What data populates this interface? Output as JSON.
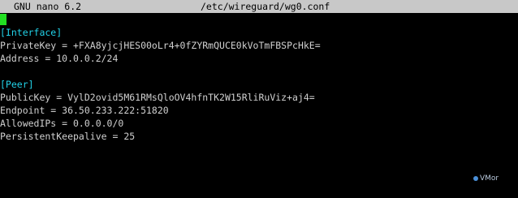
{
  "titlebar": {
    "app_name": "GNU nano 6.2",
    "file_name": "/etc/wireguard/wg0.conf"
  },
  "editor": {
    "lines": [
      {
        "text": "[Interface]",
        "kind": "section"
      },
      {
        "text": "PrivateKey = +FXA8yjcjHES00oLr4+0fZYRmQUCE0kVoTmFBSPcHkE=",
        "kind": "kv"
      },
      {
        "text": "Address = 10.0.0.2/24",
        "kind": "kv"
      },
      {
        "text": "",
        "kind": "blank"
      },
      {
        "text": "[Peer]",
        "kind": "section"
      },
      {
        "text": "PublicKey = VylD2ovid5M61RMsQloOV4hfnTK2W15RliRuViz+aj4=",
        "kind": "kv"
      },
      {
        "text": "Endpoint = 36.50.233.222:51820",
        "kind": "kv"
      },
      {
        "text": "AllowedIPs = 0.0.0.0/0",
        "kind": "kv"
      },
      {
        "text": "PersistentKeepalive = 25",
        "kind": "kv"
      }
    ]
  },
  "watermark": {
    "text": "VMor",
    "icon": "logo-dot-icon"
  },
  "colors": {
    "titlebar_bg": "#c8c8c8",
    "cursor": "#22e022",
    "section_header": "#22d2e8",
    "text": "#d0d0d0",
    "background": "#000000"
  }
}
